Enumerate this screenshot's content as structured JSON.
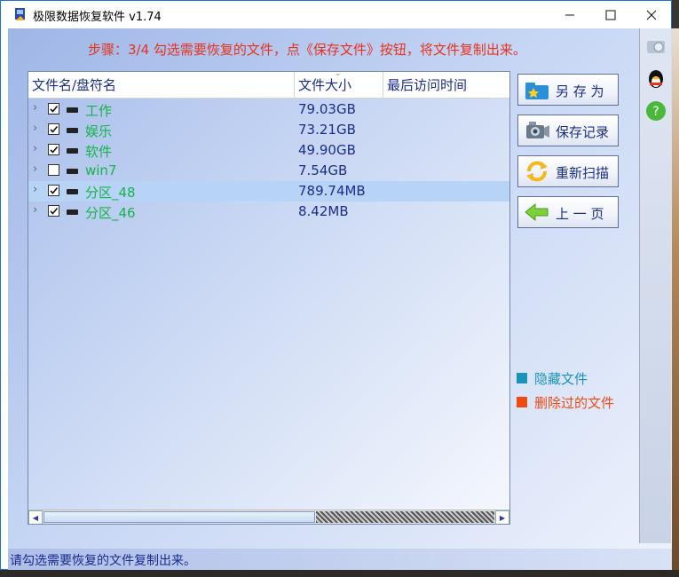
{
  "window": {
    "title": "极限数据恢复软件 v1.74"
  },
  "step_text": "步骤：3/4 勾选需要恢复的文件，点《保存文件》按钮，将文件复制出来。",
  "columns": [
    "文件名/盘符名",
    "文件大小",
    "最后访问时间"
  ],
  "rows": [
    {
      "name": "工作",
      "size": "79.03GB",
      "checked": true,
      "selected": false
    },
    {
      "name": "娱乐",
      "size": "73.21GB",
      "checked": true,
      "selected": false
    },
    {
      "name": "软件",
      "size": "49.90GB",
      "checked": true,
      "selected": false
    },
    {
      "name": "win7",
      "size": "7.54GB",
      "checked": false,
      "selected": false
    },
    {
      "name": "分区_48",
      "size": "789.74MB",
      "checked": true,
      "selected": true
    },
    {
      "name": "分区_46",
      "size": "8.42MB",
      "checked": true,
      "selected": false
    }
  ],
  "buttons": {
    "save_as": "另 存 为",
    "save_log": "保存记录",
    "rescan": "重新扫描",
    "prev_page": "上 一 页"
  },
  "legend": {
    "hidden": {
      "label": "隐藏文件",
      "color": "#1a93b8"
    },
    "deleted": {
      "label": "删除过的文件",
      "color": "#f04a12"
    }
  },
  "status_text": "请勾选需要恢复的文件复制出来。",
  "colors": {
    "accent": "#1a2c8c",
    "step": "#e8321e",
    "item_name": "#17b34a",
    "selection": "#b7d3f6"
  }
}
